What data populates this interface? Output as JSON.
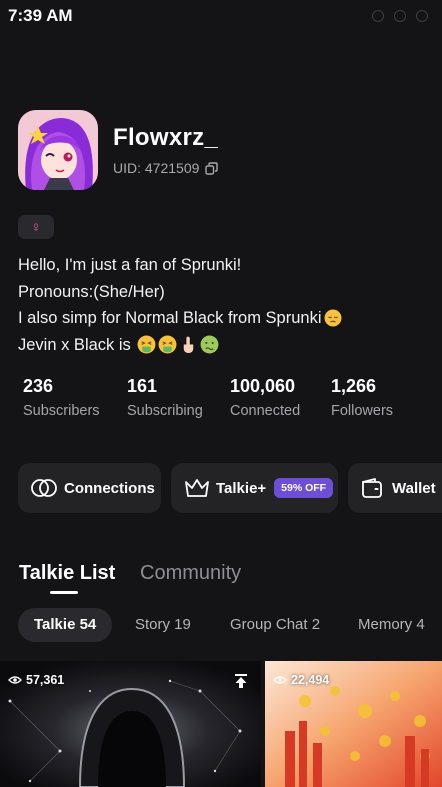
{
  "status": {
    "time": "7:39 AM"
  },
  "profile": {
    "username": "Flowxrz_",
    "uid": "UID: 4721509",
    "gender_symbol": "♀",
    "bio": [
      "Hello, I'm just a fan of Sprunki!",
      "Pronouns:(She/Her)",
      "I also simp for Normal Black from Sprunki",
      "Jevin x Black is"
    ]
  },
  "stats": [
    {
      "value": "236",
      "label": "Subscribers"
    },
    {
      "value": "161",
      "label": "Subscribing"
    },
    {
      "value": "100,060",
      "label": "Connected"
    },
    {
      "value": "1,266",
      "label": "Followers"
    }
  ],
  "actions": {
    "connections": "Connections",
    "talkie_plus": "Talkie+",
    "promo": "59% OFF",
    "wallet": "Wallet"
  },
  "tabs": {
    "talkie_list": "Talkie List",
    "community": "Community"
  },
  "chips": [
    "Talkie 54",
    "Story 19",
    "Group Chat 2",
    "Memory 4"
  ],
  "cards": [
    {
      "views": "57,361"
    },
    {
      "views": "22,494"
    }
  ],
  "colors": {
    "background": "#141416",
    "accent": "#6d4fd6",
    "surface": "#232326",
    "gender": "#e05aa8"
  },
  "icons": {
    "uid_copy": "copy-icon",
    "connections": "connections-icon",
    "talkie_plus": "crown-icon",
    "wallet": "wallet-icon",
    "views": "eye-icon",
    "pin": "pin-top-icon"
  }
}
